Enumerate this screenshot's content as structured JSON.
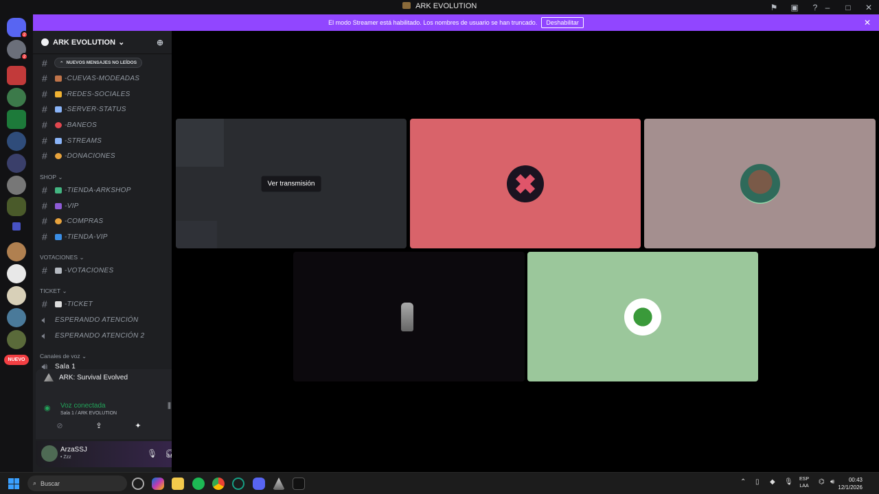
{
  "window": {
    "title": "ARK EVOLUTION"
  },
  "banner": {
    "text": "El modo Streamer está habilitado. Los nombres de usuario se han truncado.",
    "button_label": "Deshabilitar",
    "close_glyph": "✕"
  },
  "guild_rail": {
    "new_badge": "NUEVO",
    "badges": [
      "2",
      "2"
    ]
  },
  "server": {
    "name": "ARK EVOLUTION",
    "chevron": "⌄"
  },
  "unread_pill": "NUEVOS MENSAJES NO LEÍDOS",
  "channels": [
    {
      "name": "-CUEVAS-MODEADAS",
      "emoji_color": "#c0744a"
    },
    {
      "name": "-REDES-SOCIALES",
      "emoji_color": "#f0b232"
    },
    {
      "name": "-SERVER-STATUS",
      "emoji_color": "#8ab4f8"
    },
    {
      "name": "-BANEOS",
      "emoji_color": "#e0474f"
    },
    {
      "name": "-STREAMS",
      "emoji_color": "#8ab4f8"
    },
    {
      "name": "-DONACIONES",
      "emoji_color": "#e8a33d"
    }
  ],
  "categories": {
    "shop": "SHOP",
    "votaciones": "VOTACIONES",
    "ticket": "TICKET",
    "voice": "Canales de voz"
  },
  "shop_channels": [
    {
      "name": "-TIENDA-ARKSHOP",
      "emoji_color": "#43b581"
    },
    {
      "name": "-VIP",
      "emoji_color": "#8e5bd6"
    },
    {
      "name": "-COMPRAS",
      "emoji_color": "#e8a33d"
    },
    {
      "name": "-TIENDA-VIP",
      "emoji_color": "#3a8ee6"
    }
  ],
  "vote_channels": [
    {
      "name": "-VOTACIONES",
      "emoji_color": "#b5bac1"
    }
  ],
  "ticket_channels": [
    {
      "name": "-TICKET",
      "emoji_color": "#dddddd"
    }
  ],
  "voice_channels": [
    {
      "name": "ESPERANDO ATENCIÓN"
    },
    {
      "name": "ESPERANDO ATENCIÓN 2"
    },
    {
      "name": "Sala 1"
    }
  ],
  "rtc": {
    "game": "ARK: Survival Evolved",
    "status": "Voz conectada",
    "location": "Sala 1 / ARK EVOLUTION"
  },
  "user": {
    "name": "ArzaSSJ",
    "status": "• Zzz"
  },
  "stage": {
    "watch_label": "Ver transmisión",
    "tile_colors": {
      "stream": "#2a2c30",
      "tile2": "#d9636a",
      "tile3": "#a48f8f",
      "tile4": "#0c090d",
      "tile5": "#9bc79b"
    }
  },
  "taskbar": {
    "search_placeholder": "Buscar",
    "lang_top": "ESP",
    "lang_bottom": "LAA",
    "time": "00:43",
    "date": "12/1/2026"
  }
}
